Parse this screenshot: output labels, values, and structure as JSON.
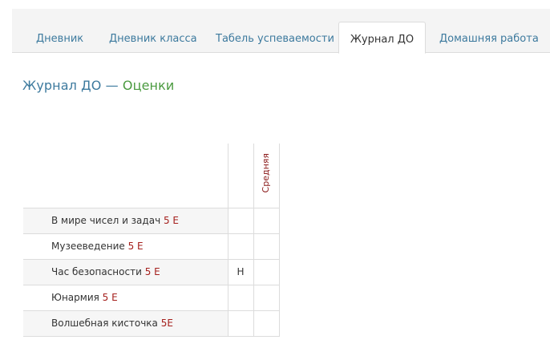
{
  "tabs": [
    {
      "label": "Дневник",
      "active": false
    },
    {
      "label": "Дневник класса",
      "active": false
    },
    {
      "label": "Табель успеваемости",
      "active": false
    },
    {
      "label": "Журнал ДО",
      "active": true
    },
    {
      "label": "Домашняя работа",
      "active": false
    }
  ],
  "title": {
    "part1": "Журнал ДО — ",
    "part2": "Оценки"
  },
  "table": {
    "avg_header": "Средняя",
    "rows": [
      {
        "subject": "В мире чисел и задач",
        "grade": "5 Е",
        "mark": ""
      },
      {
        "subject": "Музееведение",
        "grade": "5 Е",
        "mark": ""
      },
      {
        "subject": "Час безопасности",
        "grade": "5 Е",
        "mark": "Н"
      },
      {
        "subject": "Юнармия",
        "grade": "5 Е",
        "mark": ""
      },
      {
        "subject": "Волшебная кисточка",
        "grade": "5Е",
        "mark": ""
      }
    ]
  },
  "colors": {
    "link": "#3d7a9e",
    "accent_green": "#4a9a3f",
    "grade_red": "#a5201d"
  }
}
